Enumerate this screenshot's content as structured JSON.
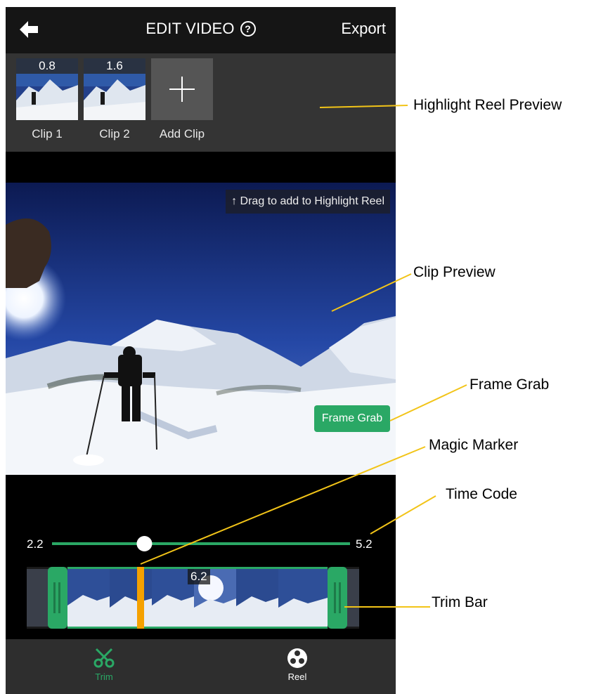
{
  "header": {
    "title": "EDIT VIDEO",
    "help_icon": "?",
    "export_label": "Export"
  },
  "reel": {
    "clips": [
      {
        "duration": "0.8",
        "label": "Clip 1"
      },
      {
        "duration": "1.6",
        "label": "Clip 2"
      }
    ],
    "add_label": "Add Clip"
  },
  "preview": {
    "hint": "↑ Drag to add to Highlight Reel",
    "frame_grab_label": "Frame Grab"
  },
  "scrubber": {
    "start": "2.2",
    "end": "5.2",
    "position_fraction": 0.31
  },
  "trim": {
    "timecode": "6.2"
  },
  "tabs": {
    "trim_label": "Trim",
    "reel_label": "Reel",
    "active_color": "#2aa865"
  },
  "callouts": {
    "highlight_reel_preview": "Highlight Reel Preview",
    "clip_preview": "Clip Preview",
    "frame_grab": "Frame Grab",
    "magic_marker": "Magic Marker",
    "time_code": "Time Code",
    "trim_bar": "Trim Bar"
  },
  "colors": {
    "accent": "#2aa865",
    "marker": "#f5a100",
    "callout_line": "#f2c418"
  }
}
